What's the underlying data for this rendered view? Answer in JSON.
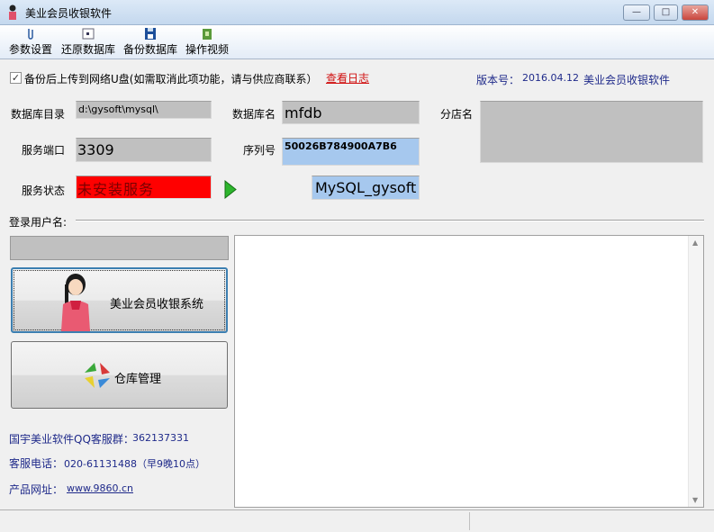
{
  "window": {
    "title": "美业会员收银软件",
    "minimize": "—",
    "maximize": "□",
    "close": "✕",
    "close_color": "#c9463d"
  },
  "toolbar": {
    "items": [
      {
        "label": "参数设置",
        "icon": "paperclip-icon"
      },
      {
        "label": "还原数据库",
        "icon": "window-icon"
      },
      {
        "label": "备份数据库",
        "icon": "floppy-disk-icon"
      },
      {
        "label": "操作视频",
        "icon": "video-icon"
      }
    ]
  },
  "backup": {
    "checked": true,
    "label": "备份后上传到网络U盘(如需取消此项功能，请与供应商联系）",
    "view_log": "查看日志"
  },
  "version": {
    "label": "版本号：",
    "value": "2016.04.12",
    "product": "美业会员收银软件"
  },
  "form": {
    "db_dir_label": "数据库目录",
    "db_dir": "d:\\gysoft\\mysql\\",
    "db_name_label": "数据库名",
    "db_name": "mfdb",
    "branch_label": "分店名",
    "branch": "",
    "port_label": "服务端口",
    "port": "3309",
    "serial_label": "序列号",
    "serial": "50026B784900A7B6",
    "status_label": "服务状态",
    "status": "未安装服务",
    "status_color": "#ff0000",
    "service_name": "MySQL_gysoft"
  },
  "login": {
    "label": "登录用户名:",
    "value": ""
  },
  "buttons": {
    "cashier": "美业会员收银系统",
    "warehouse": "仓库管理"
  },
  "info": {
    "qq_label": "国宇美业软件QQ客服群：",
    "qq": "362137331",
    "phone_label": "客服电话：",
    "phone": "020-61131488（早9晚10点）",
    "site_label": "产品网址：",
    "site": "www.9860.cn"
  },
  "log": {
    "content": ""
  }
}
